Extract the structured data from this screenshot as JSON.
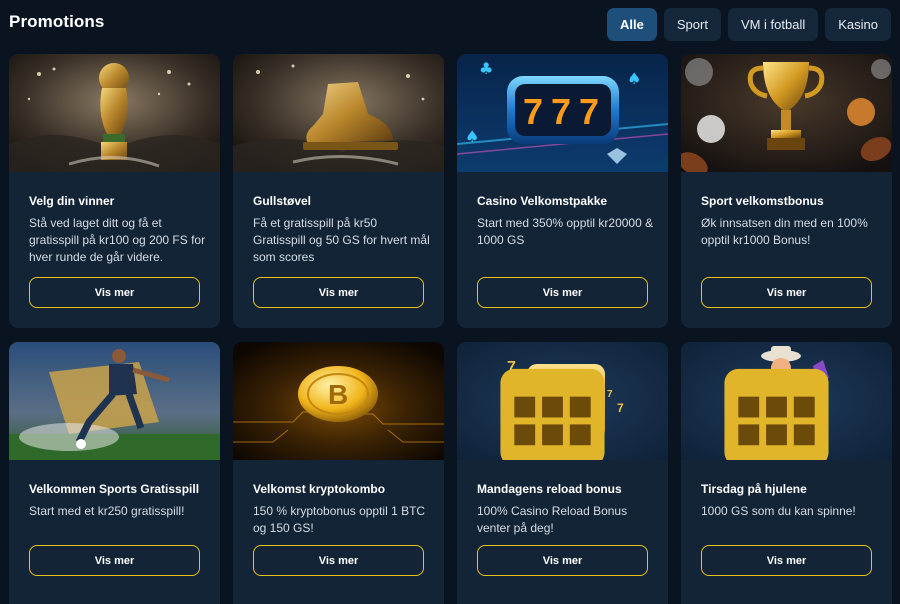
{
  "header": {
    "title": "Promotions",
    "filters": [
      {
        "label": "Alle",
        "active": true
      },
      {
        "label": "Sport",
        "active": false
      },
      {
        "label": "VM i fotball",
        "active": false
      },
      {
        "label": "Kasino",
        "active": false
      }
    ]
  },
  "colors": {
    "background": "#0a1420",
    "card": "#132436",
    "accent_border": "#e8c21e",
    "active_tab": "#1d4f7a"
  },
  "promotions": [
    {
      "title": "Velg din vinner",
      "description": "Stå ved laget ditt og få et gratisspill på kr100 og 200 FS for hver runde de går videre.",
      "button": "Vis mer",
      "image_icon": "world-cup-trophy-icon"
    },
    {
      "title": "Gullstøvel",
      "description": "Få et gratisspill på kr50 Gratisspill og 50 GS for hvert mål som scores",
      "button": "Vis mer",
      "image_icon": "golden-boot-icon"
    },
    {
      "title": "Casino Velkomstpakke",
      "description": "Start med 350% opptil kr20000 & 1000 GS",
      "button": "Vis mer",
      "image_icon": "slot-reel-777-icon"
    },
    {
      "title": "Sport velkomstbonus",
      "description": "Øk innsatsen din med en 100% opptil kr1000 Bonus!",
      "button": "Vis mer",
      "image_icon": "golden-cup-trophy-icon"
    },
    {
      "title": "Velkommen Sports Gratisspill",
      "description": "Start med et kr250 gratisspill!",
      "button": "Vis mer",
      "image_icon": "football-player-icon"
    },
    {
      "title": "Velkomst kryptokombo",
      "description": "150 % kryptobonus opptil 1 BTC og 150 GS!",
      "button": "Vis mer",
      "image_icon": "bitcoin-coin-icon"
    },
    {
      "title": "Mandagens reload bonus",
      "description": "100% Casino Reload Bonus venter på deg!",
      "button": "Vis mer",
      "image_icon": "slot-machine-icon"
    },
    {
      "title": "Tirsdag på hjulene",
      "description": "1000 GS som du kan spinne!",
      "button": "Vis mer",
      "image_icon": "cowboy-character-icon"
    }
  ]
}
